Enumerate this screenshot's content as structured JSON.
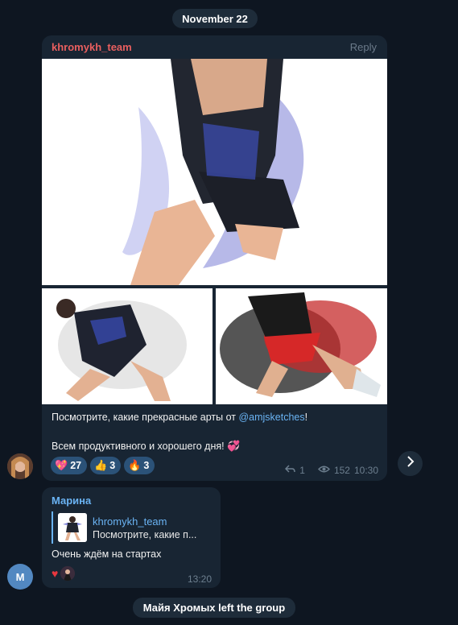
{
  "date_separator": "November 22",
  "post": {
    "author": "khromykh_team",
    "reply_label": "Reply",
    "text_line1_before": "Посмотрите, какие прекрасные арты от ",
    "mention": "@amjsketches",
    "text_line1_after": "!",
    "text_line2": "Всем продуктивного и хорошего дня! ",
    "text_line2_emoji": "💞",
    "reactions": [
      {
        "emoji": "💖",
        "count": "27"
      },
      {
        "emoji": "👍",
        "count": "3"
      },
      {
        "emoji": "🔥",
        "count": "3"
      }
    ],
    "replies_count": "1",
    "views": "152",
    "time": "10:30",
    "reply_icon": "reply-arrow-icon",
    "views_icon": "eye-icon"
  },
  "forward_icon": "chevron-right-icon",
  "reply_message": {
    "author": "Марина",
    "quoted_author": "khromykh_team",
    "quoted_snippet": "Посмотрите, какие п...",
    "text": "Очень ждём на стартах",
    "reaction_emoji": "♥",
    "time": "13:20",
    "avatar_letter": "M"
  },
  "service_message": "Майя Хромых left the group",
  "colors": {
    "background": "#0e1621",
    "bubble": "#182533",
    "accent": "#6ab3f3",
    "author_red": "#e95f5f",
    "reaction_bg": "#2b5278"
  }
}
